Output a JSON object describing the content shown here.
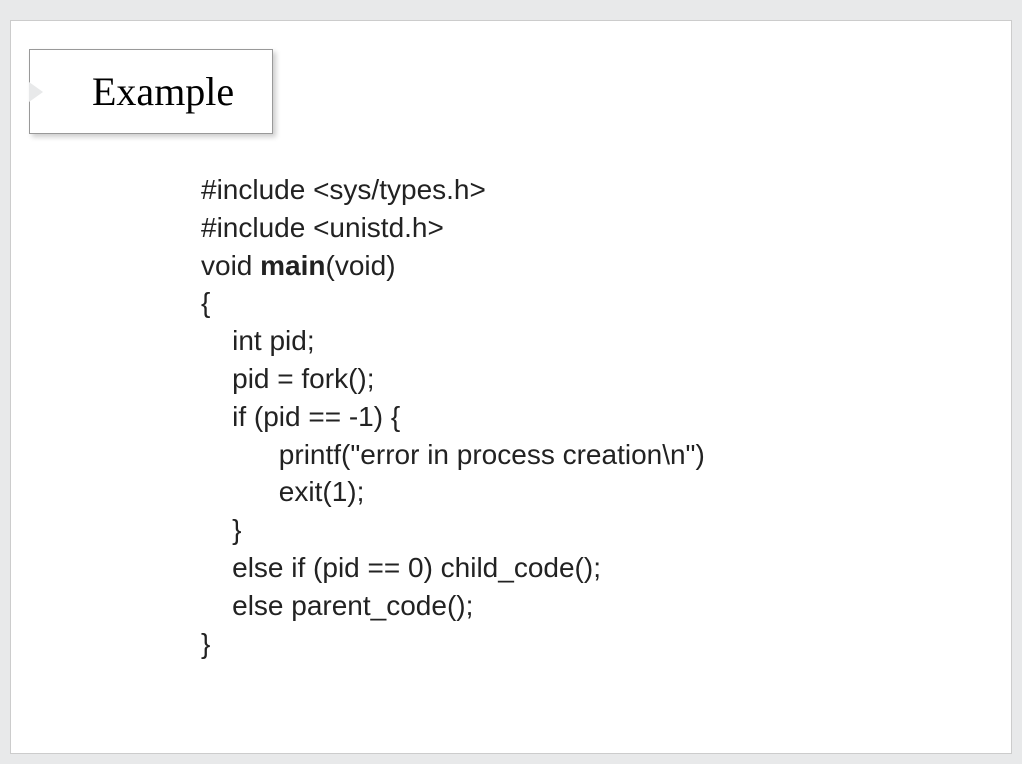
{
  "slide": {
    "title": "Example",
    "code": {
      "line1": "#include <sys/types.h>",
      "line2": "#include <unistd.h>",
      "line3": "",
      "line4a": "void ",
      "line4b": "main",
      "line4c": "(void)",
      "line5": "{",
      "line6": "    int pid;",
      "line7": "    pid = fork();",
      "line8": "    if (pid == -1) {",
      "line9": "          printf(\"error in process creation\\n\")",
      "line10": "          exit(1);",
      "line11": "    }",
      "line12": "    else if (pid == 0) child_code();",
      "line13": "    else parent_code();",
      "line14": "}"
    }
  }
}
